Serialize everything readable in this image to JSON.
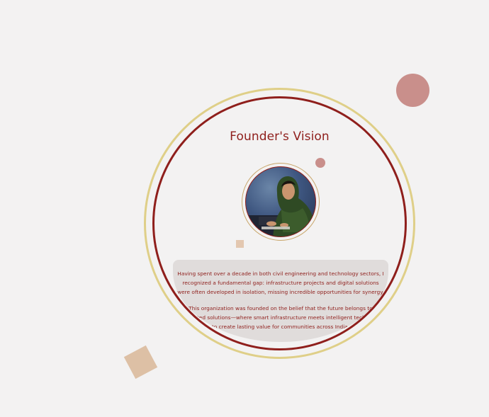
{
  "section": {
    "title": "Founder's Vision",
    "portrait_alt": "Founder portrait",
    "paragraphs": [
      "Having spent over a decade in both civil engineering and technology sectors, I recognized a fundamental gap: infrastructure projects and digital solutions were often developed in isolation, missing incredible opportunities for synergy.",
      "This organization was founded on the belief that the future belongs to integrated solutions—where smart infrastructure meets intelligent technology to create lasting value for communities across India."
    ]
  },
  "colors": {
    "background": "#f3f2f2",
    "accent_red": "#8f1f1c",
    "accent_gold": "#dfcf88",
    "rose": "#c98f8b",
    "sand": "#ddc0a5",
    "panel": "#e0dcdb"
  }
}
